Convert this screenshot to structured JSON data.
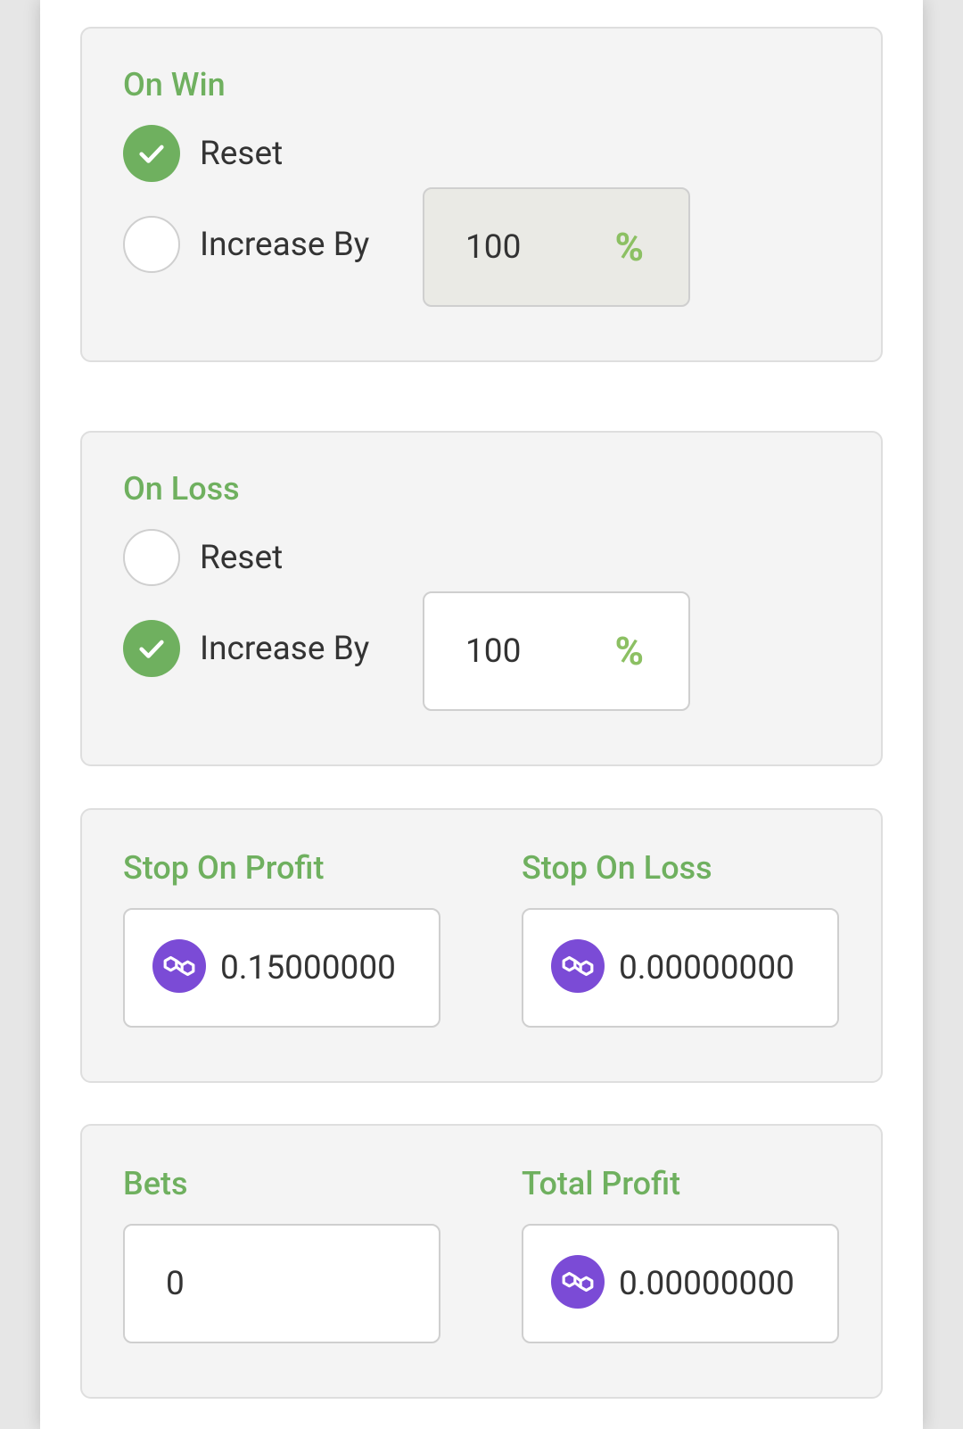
{
  "on_win": {
    "title": "On Win",
    "reset_label": "Reset",
    "reset_checked": true,
    "increase_label": "Increase By",
    "increase_checked": false,
    "increase_value": "100",
    "increase_unit": "%"
  },
  "on_loss": {
    "title": "On Loss",
    "reset_label": "Reset",
    "reset_checked": false,
    "increase_label": "Increase By",
    "increase_checked": true,
    "increase_value": "100",
    "increase_unit": "%"
  },
  "stop": {
    "profit_title": "Stop On Profit",
    "profit_value": "0.15000000",
    "loss_title": "Stop On Loss",
    "loss_value": "0.00000000"
  },
  "stats": {
    "bets_title": "Bets",
    "bets_value": "0",
    "profit_title": "Total Profit",
    "profit_value": "0.00000000"
  },
  "icons": {
    "check": "check-icon",
    "coin": "polygon-coin-icon"
  },
  "colors": {
    "accent_green": "#6fb05f",
    "percent_green": "#8cc063",
    "coin_purple": "#7b4bd6"
  }
}
